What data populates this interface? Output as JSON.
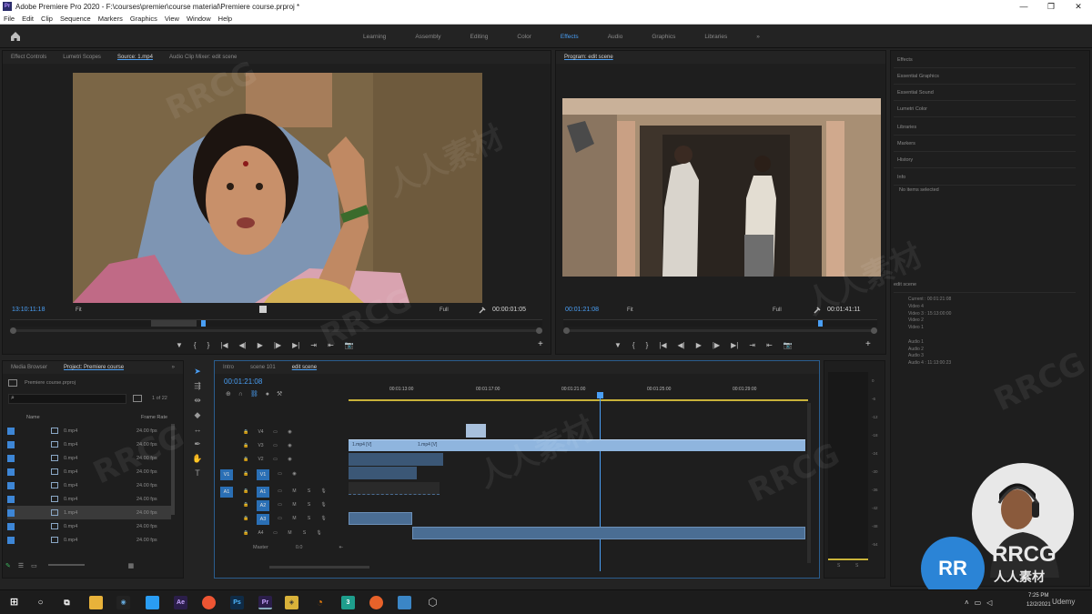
{
  "window": {
    "title": "Adobe Premiere Pro 2020 - F:\\courses\\premier\\course material\\Premiere course.prproj *",
    "app_icon": "Pr",
    "controls": [
      "—",
      "❐",
      "✕"
    ]
  },
  "menu": [
    "File",
    "Edit",
    "Clip",
    "Sequence",
    "Markers",
    "Graphics",
    "View",
    "Window",
    "Help"
  ],
  "workspaces": {
    "tabs": [
      "Learning",
      "Assembly",
      "Editing",
      "Color",
      "Effects",
      "Audio",
      "Graphics",
      "Libraries"
    ],
    "active": "Effects",
    "more": "»"
  },
  "source_panel": {
    "tabs": [
      "Effect Controls",
      "Lumetri Scopes",
      "Source: 1.mp4",
      "Audio Clip Mixer: edit scene"
    ],
    "active_tab": "Source: 1.mp4",
    "timecode": "13:10:11:18",
    "fit": "Fit",
    "quality": "Full",
    "duration": "00:00:01:05"
  },
  "program_panel": {
    "title": "Program: edit scene",
    "timecode": "00:01:21:08",
    "fit": "Fit",
    "quality": "Full",
    "duration": "00:01:41:11"
  },
  "transport_buttons": [
    "▼",
    "{",
    "}",
    "|◀",
    "◀|",
    "▶",
    "|▶",
    "▶|",
    "⇥",
    "⇤",
    "📷"
  ],
  "project_panel": {
    "tabs": [
      "Media Browser",
      "Project: Premiere course"
    ],
    "active_tab": "Project: Premiere course",
    "file": "Premiere course.prproj",
    "count": "1 of 22",
    "columns": [
      "Name",
      "Frame Rate"
    ],
    "rows": [
      {
        "name": "0.mp4",
        "fps": "24.00 fps"
      },
      {
        "name": "0.mp4",
        "fps": "24.00 fps"
      },
      {
        "name": "0.mp4",
        "fps": "24.00 fps"
      },
      {
        "name": "0.mp4",
        "fps": "24.00 fps"
      },
      {
        "name": "0.mp4",
        "fps": "24.00 fps"
      },
      {
        "name": "0.mp4",
        "fps": "24.00 fps"
      },
      {
        "name": "1.mp4",
        "fps": "24.00 fps"
      },
      {
        "name": "0.mp4",
        "fps": "24.00 fps"
      },
      {
        "name": "0.mp4",
        "fps": "24.00 fps"
      }
    ],
    "selected_row": 6
  },
  "timeline": {
    "tabs": [
      "Intro",
      "scene 101",
      "edit scene"
    ],
    "active_tab": "edit scene",
    "timecode": "00:01:21:08",
    "ruler": [
      "00:01:13:00",
      "00:01:17:00",
      "00:01:21:00",
      "00:01:25:00",
      "00:01:29:00"
    ],
    "video_tracks": [
      {
        "label": "V4"
      },
      {
        "label": "V3"
      },
      {
        "label": "V2"
      },
      {
        "label": "V1",
        "source": "V1"
      }
    ],
    "audio_tracks": [
      {
        "label": "A1",
        "source": "A1",
        "m": "M",
        "s": "S"
      },
      {
        "label": "A2",
        "m": "M",
        "s": "S"
      },
      {
        "label": "A3",
        "m": "M",
        "s": "S"
      },
      {
        "label": "A4",
        "m": "M",
        "s": "S"
      }
    ],
    "master": {
      "label": "Master",
      "value": "0.0"
    },
    "clips": [
      "1.mp4 [V]",
      "1.mp4 [V]",
      "fx"
    ]
  },
  "audio_meter": {
    "scale": [
      "0",
      "-6",
      "-12",
      "-18",
      "-24",
      "-30",
      "-36",
      "-42",
      "-48",
      "-54"
    ],
    "footer": [
      "S",
      "S"
    ]
  },
  "right_panel": {
    "items": [
      "Effects",
      "Essential Graphics",
      "Essential Sound",
      "Lumetri Color",
      "Libraries",
      "Markers",
      "History",
      "Info"
    ],
    "info_text": "No items selected",
    "edit_info": {
      "title": "edit scene",
      "lines": [
        "Current : 00:01:21:08",
        "Video 4",
        "Video 3 : 15:13:00:00",
        "Video 2",
        "Video 1",
        "",
        "Audio 1",
        "Audio 2",
        "Audio 3",
        "Audio 4 : 11:13:00:23"
      ]
    }
  },
  "taskbar": {
    "time": "7:25 PM",
    "date": "12/2/2021",
    "user": "Udemy"
  },
  "watermark": {
    "text": "RRCG",
    "cn": "人人素材",
    "badge": "RR"
  }
}
